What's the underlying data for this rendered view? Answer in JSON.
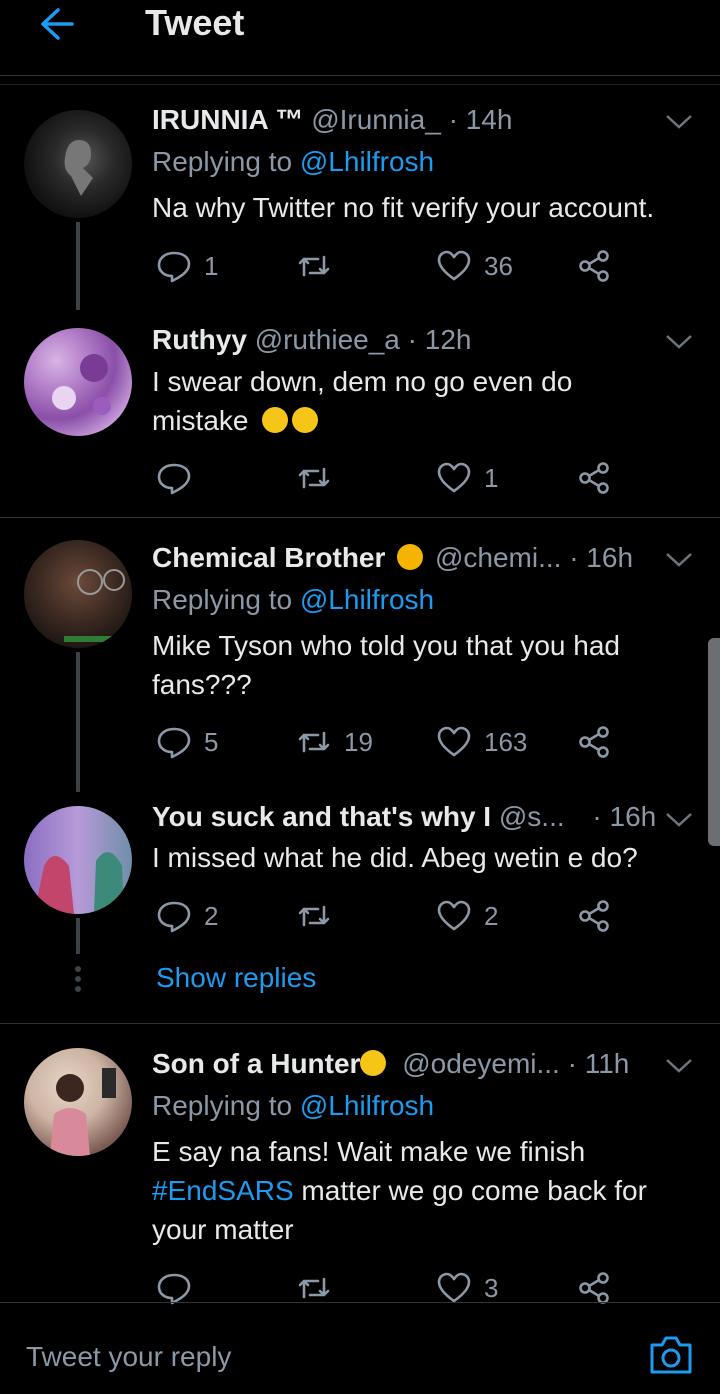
{
  "header": {
    "title": "Tweet"
  },
  "tweets": [
    {
      "name": "IRUNNIA ™",
      "handle": "@Irunnia_",
      "time": "· 14h",
      "replying_label": "Replying to",
      "replying_to": "@Lhilfrosh",
      "text": "Na why Twitter no fit verify your account.",
      "replies": "1",
      "retweets": "",
      "likes": "36"
    },
    {
      "name": "Ruthyy",
      "handle": "@ruthiee_a",
      "time": "· 12h",
      "text_line1": "I swear down, dem no go even do",
      "text_line2": "mistake",
      "replies": "",
      "retweets": "",
      "likes": "1"
    },
    {
      "name": "Chemical Brother",
      "handle": "@chemi...",
      "time": "· 16h",
      "replying_label": "Replying to",
      "replying_to": "@Lhilfrosh",
      "text_line1": "Mike Tyson who told you that you had",
      "text_line2": "fans???",
      "replies": "5",
      "retweets": "19",
      "likes": "163"
    },
    {
      "name": "You suck and that's why I",
      "handle": "@s...",
      "time": "· 16h",
      "text": "I missed what he did. Abeg wetin e do?",
      "replies": "2",
      "retweets": "",
      "likes": "2"
    },
    {
      "name": "Son of a Hunter",
      "handle": "@odeyemi...",
      "time": "· 11h",
      "replying_label": "Replying to",
      "replying_to": "@Lhilfrosh",
      "text_line1": "E say na fans! Wait make we finish",
      "hashtag": "#EndSARS",
      "text_line2_rest": " matter we go come back for",
      "text_line3": "your matter",
      "replies": "",
      "retweets": "",
      "likes": "3"
    }
  ],
  "show_replies": "Show replies",
  "reply_bar": {
    "placeholder": "Tweet your reply"
  },
  "colors": {
    "accent": "#1d9bf0",
    "muted": "#8b98a5",
    "text": "#e7e9ea",
    "background": "#000000"
  }
}
